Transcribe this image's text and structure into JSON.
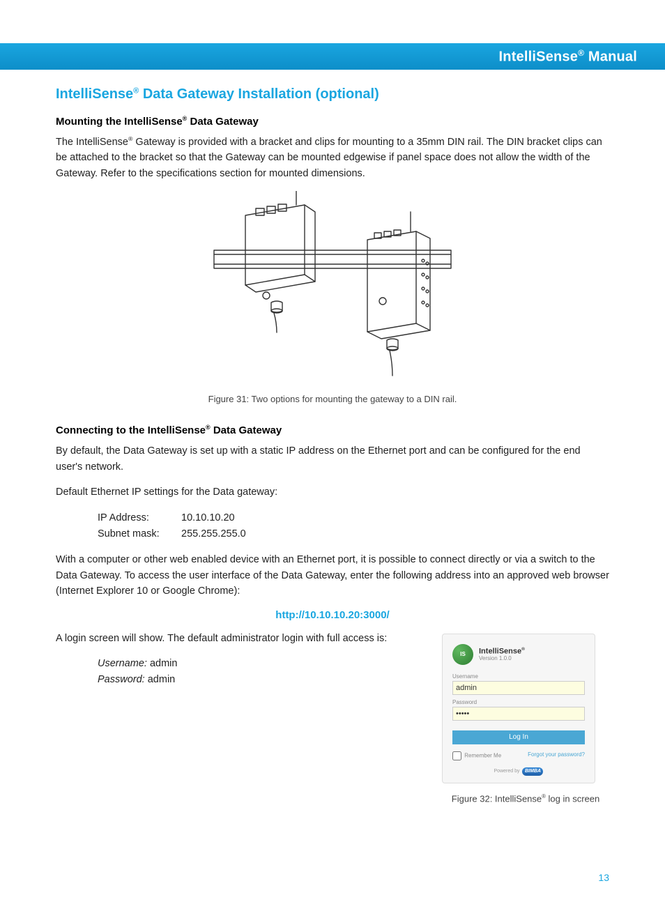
{
  "header": {
    "title_pre": "IntelliSense",
    "title_reg": "®",
    "title_post": " Manual"
  },
  "section": {
    "title_pre": "IntelliSense",
    "title_reg": "®",
    "title_post": " Data Gateway Installation (optional)"
  },
  "mounting": {
    "heading_pre": "Mounting the IntelliSense",
    "heading_reg": "®",
    "heading_post": " Data Gateway",
    "body_pre": "The IntelliSense",
    "body_reg": "®",
    "body_post": " Gateway is provided with a bracket and clips for mounting to a 35mm DIN rail. The DIN bracket clips can be attached to the bracket so that the Gateway can be mounted edgewise if panel space does not allow the width of the Gateway. Refer to the specifications section for mounted dimensions.",
    "fig_caption": "Figure 31: Two options for mounting the gateway to a DIN rail."
  },
  "connecting": {
    "heading_pre": "Connecting to the IntelliSense",
    "heading_reg": "®",
    "heading_post": " Data Gateway",
    "p1": "By default, the Data Gateway is set up with a static IP address on the Ethernet port and can be configured for the end user's network.",
    "p2": "Default Ethernet IP settings for the Data gateway:",
    "ip_label": "IP Address:",
    "ip_value": "10.10.10.20",
    "mask_label": "Subnet mask:",
    "mask_value": "255.255.255.0",
    "p3": "With a computer or other web enabled device with an Ethernet port, it is possible to connect directly or via a switch to the Data Gateway. To access the user interface of the Data Gateway, enter the following address into an approved web browser (Internet Explorer 10 or Google Chrome):",
    "url": "http://10.10.10.20:3000/",
    "p4": "A login screen will show. The default administrator login with full access is:",
    "user_label": "Username:",
    "user_value": " admin",
    "pass_label": "Password:",
    "pass_value": " admin"
  },
  "login": {
    "logo_text": "IS",
    "title_pre": "IntelliSense",
    "title_reg": "®",
    "version": "Version 1.0.0",
    "username_label": "Username",
    "username_value": "admin",
    "password_label": "Password",
    "password_value": "•••••",
    "button": "Log In",
    "remember": "Remember Me",
    "forgot": "Forgot your password?",
    "powered": "Powered by",
    "brand": "BIMBA",
    "fig_caption_pre": "Figure 32: IntelliSense",
    "fig_caption_reg": "®",
    "fig_caption_post": " log in screen"
  },
  "page_number": "13"
}
